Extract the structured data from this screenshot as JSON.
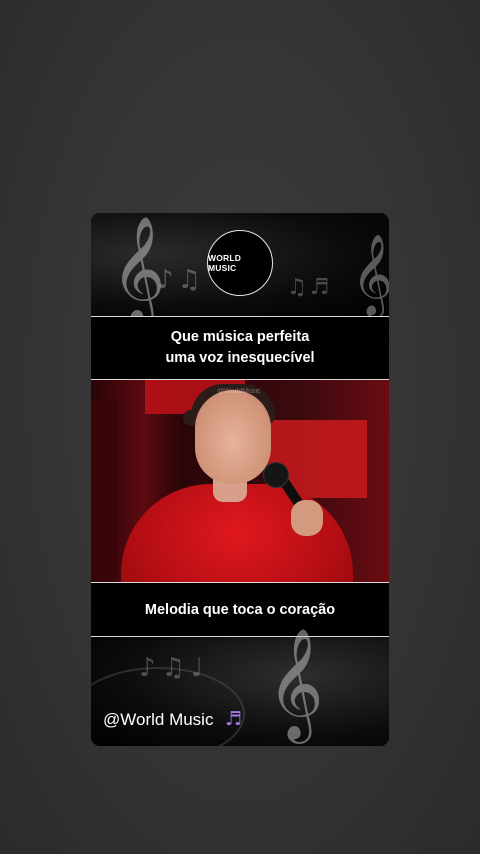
{
  "logo": {
    "text": "WORLD MUSIC"
  },
  "caption_top": {
    "line1": "Que música perfeita",
    "line2": "uma voz inesquecível"
  },
  "video": {
    "watermark": "@WorldMusic"
  },
  "caption_bottom": {
    "text": "Melodia que toca o coração"
  },
  "footer": {
    "handle": "@World Music",
    "icon": "musical-notes-icon"
  },
  "colors": {
    "background": "#353334",
    "card": "#000000",
    "accent_red": "#d31a1e",
    "icon_purple": "#a678e8"
  }
}
